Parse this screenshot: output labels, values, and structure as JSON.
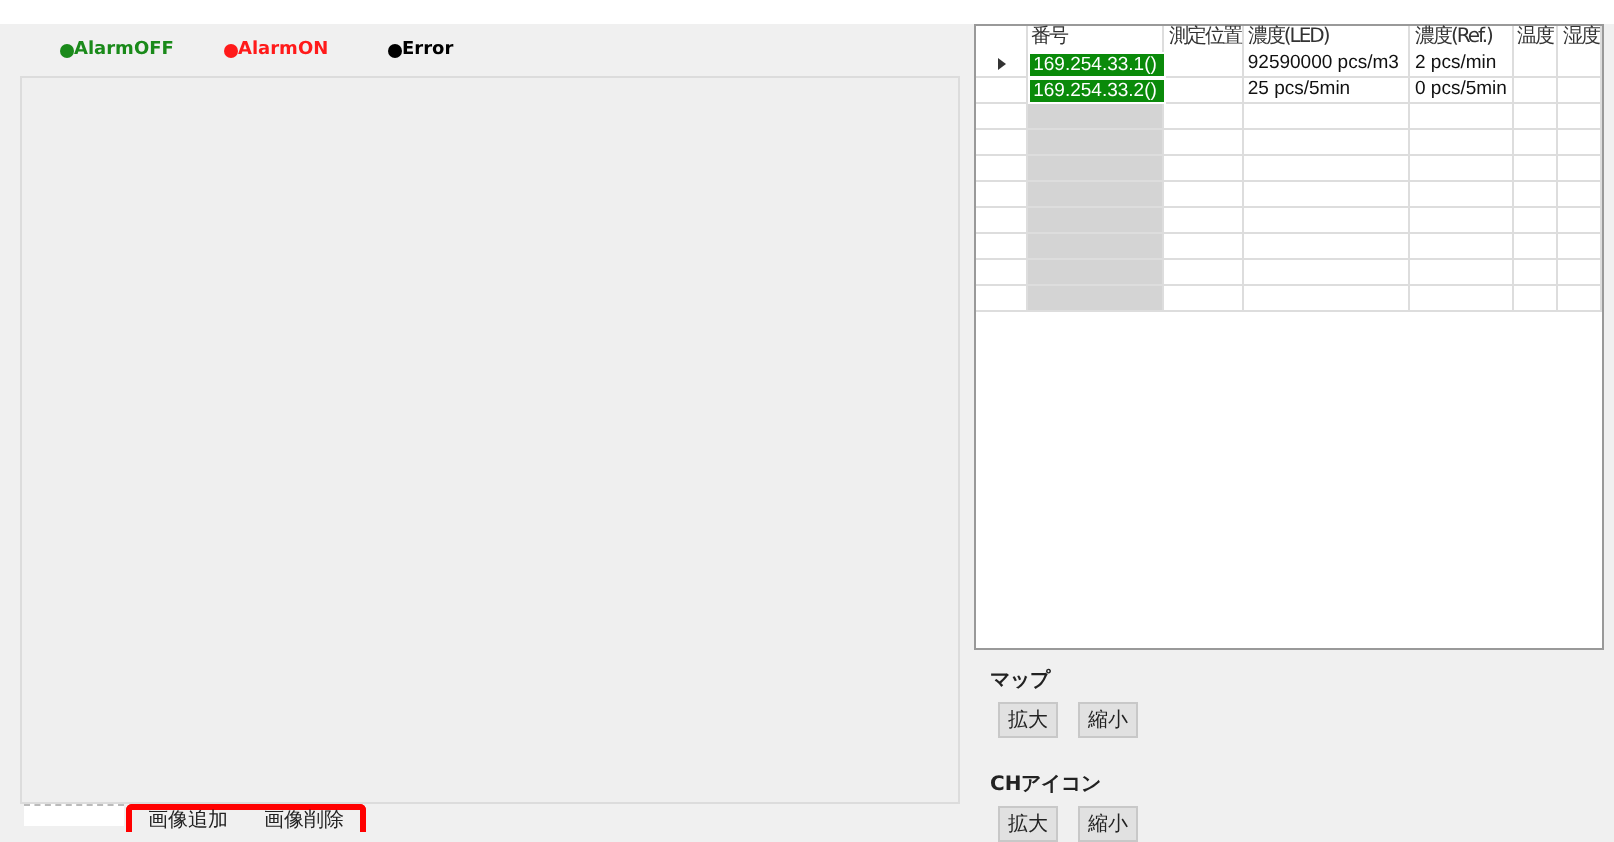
{
  "legend": [
    {
      "label": "AlarmOFF",
      "color": "#1a8a1a"
    },
    {
      "label": "AlarmON",
      "color": "#ff1a1a"
    },
    {
      "label": "Error",
      "color": "#000000"
    }
  ],
  "grid": {
    "columns": [
      "番号",
      "測定位置",
      "濃度(LED)",
      "濃度(Ref.)",
      "温度",
      "湿度"
    ],
    "rows": [
      {
        "current": true,
        "color": "#0a8a0a",
        "cells": [
          "169.254.33.1()",
          "",
          "92590000 pcs/m3",
          "2 pcs/min",
          "",
          ""
        ]
      },
      {
        "current": false,
        "color": "#0a8a0a",
        "cells": [
          "169.254.33.2()",
          "",
          "25 pcs/5min",
          "0 pcs/5min",
          "",
          ""
        ]
      }
    ]
  },
  "zoom_groups": [
    {
      "label": "マップ",
      "buttons": [
        "拡大",
        "縮小"
      ]
    },
    {
      "label": "CHアイコン",
      "buttons": [
        "拡大",
        "縮小"
      ]
    }
  ],
  "image_buttons": [
    "画像追加",
    "画像削除"
  ]
}
